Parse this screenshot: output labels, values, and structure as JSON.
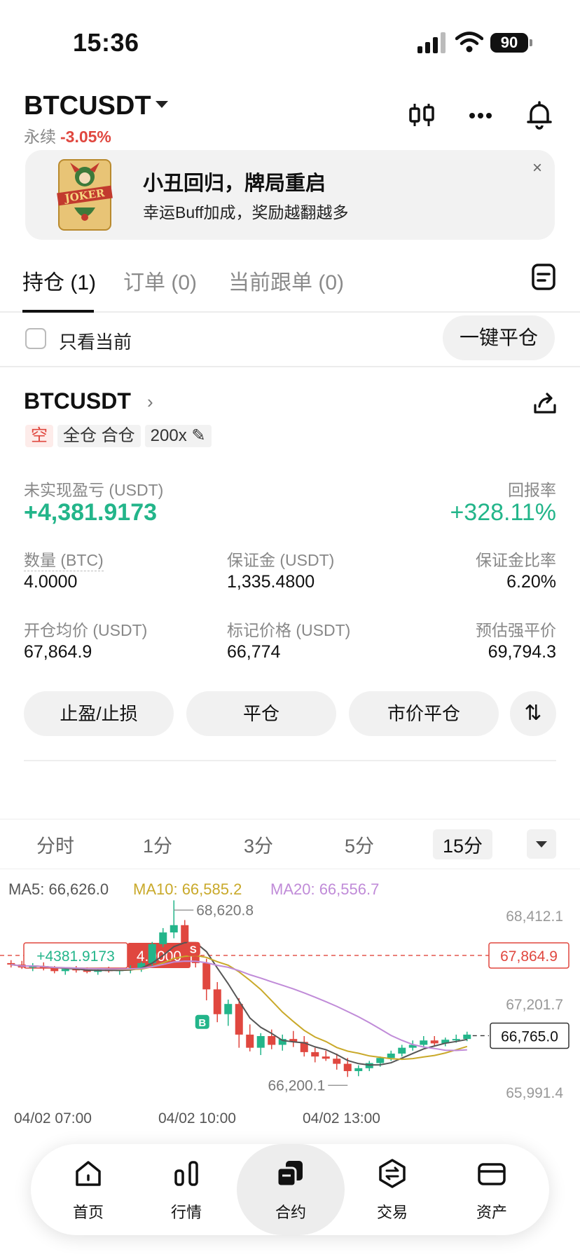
{
  "status": {
    "time": "15:36",
    "battery": "90"
  },
  "header": {
    "symbol": "BTCUSDT",
    "type": "永续",
    "change": "-3.05%"
  },
  "banner": {
    "title": "小丑回归，牌局重启",
    "subtitle": "幸运Buff加成，奖励越翻越多",
    "close": "×",
    "image_text": "JOKER"
  },
  "tabs": [
    {
      "label": "持仓 (1)"
    },
    {
      "label": "订单 (0)"
    },
    {
      "label": "当前跟单 (0)"
    }
  ],
  "filter": {
    "checkbox_label": "只看当前",
    "close_all": "一键平仓"
  },
  "position": {
    "symbol": "BTCUSDT",
    "side": "空",
    "margin_mode": "全仓 合仓",
    "leverage": "200x",
    "unrealized_label": "未实现盈亏 (USDT)",
    "unrealized_value": "+4,381.9173",
    "roe_label": "回报率",
    "roe_value": "+328.11%",
    "qty_label": "数量 (BTC)",
    "qty_value": "4.0000",
    "margin_label": "保证金 (USDT)",
    "margin_value": "1,335.4800",
    "margin_ratio_label": "保证金比率",
    "margin_ratio_value": "6.20%",
    "entry_label": "开仓均价 (USDT)",
    "entry_value": "67,864.9",
    "mark_label": "标记价格 (USDT)",
    "mark_value": "66,774",
    "liq_label": "预估强平价",
    "liq_value": "69,794.3",
    "btn_tpsl": "止盈/止损",
    "btn_close": "平仓",
    "btn_market_close": "市价平仓"
  },
  "timeframes": [
    {
      "label": "分时"
    },
    {
      "label": "1分"
    },
    {
      "label": "3分"
    },
    {
      "label": "5分"
    },
    {
      "label": "15分"
    }
  ],
  "chart_data": {
    "type": "candlestick",
    "ma": {
      "ma5": "MA5: 66,626.0",
      "ma10": "MA10: 66,585.2",
      "ma20": "MA20: 66,556.7"
    },
    "y_ticks": [
      "68,412.1",
      "67,201.7",
      "65,991.4"
    ],
    "x_ticks": [
      "04/02 07:00",
      "04/02 10:00",
      "04/02 13:00"
    ],
    "high_label": "68,620.8",
    "low_label": "66,200.1",
    "entry_line": "67,864.9",
    "current_price": "66,765.0",
    "pnl_tag": "+4381.9173",
    "qty_tag": "4.0000",
    "sell_marker": "S",
    "buy_marker": "B",
    "ylim": [
      65991.4,
      68412.1
    ],
    "candles": [
      [
        67760,
        67800,
        67700,
        67740
      ],
      [
        67740,
        67790,
        67680,
        67700
      ],
      [
        67700,
        67760,
        67650,
        67720
      ],
      [
        67720,
        67770,
        67660,
        67690
      ],
      [
        67690,
        67720,
        67620,
        67650
      ],
      [
        67650,
        67700,
        67600,
        67680
      ],
      [
        67680,
        67720,
        67630,
        67660
      ],
      [
        67660,
        67700,
        67620,
        67640
      ],
      [
        67640,
        67690,
        67600,
        67670
      ],
      [
        67670,
        67710,
        67630,
        67650
      ],
      [
        67650,
        67690,
        67600,
        67680
      ],
      [
        67680,
        67730,
        67620,
        67690
      ],
      [
        67690,
        67780,
        67640,
        67760
      ],
      [
        67760,
        68050,
        67720,
        68020
      ],
      [
        68020,
        68240,
        67980,
        68180
      ],
      [
        68180,
        68620,
        68100,
        68280
      ],
      [
        68280,
        68350,
        67900,
        67960
      ],
      [
        67960,
        68020,
        67700,
        67760
      ],
      [
        67760,
        67820,
        67250,
        67400
      ],
      [
        67400,
        67500,
        66950,
        67060
      ],
      [
        67060,
        67260,
        66900,
        67200
      ],
      [
        67200,
        67280,
        66600,
        66780
      ],
      [
        66780,
        66920,
        66550,
        66600
      ],
      [
        66600,
        66800,
        66500,
        66760
      ],
      [
        66760,
        66850,
        66580,
        66640
      ],
      [
        66640,
        66780,
        66560,
        66720
      ],
      [
        66720,
        66830,
        66610,
        66680
      ],
      [
        66680,
        66760,
        66480,
        66540
      ],
      [
        66540,
        66600,
        66400,
        66480
      ],
      [
        66480,
        66560,
        66420,
        66450
      ],
      [
        66450,
        66520,
        66300,
        66380
      ],
      [
        66380,
        66460,
        66200,
        66280
      ],
      [
        66280,
        66360,
        66210,
        66320
      ],
      [
        66320,
        66420,
        66280,
        66390
      ],
      [
        66390,
        66480,
        66340,
        66460
      ],
      [
        66460,
        66560,
        66420,
        66520
      ],
      [
        66520,
        66640,
        66480,
        66600
      ],
      [
        66600,
        66700,
        66560,
        66640
      ],
      [
        66640,
        66760,
        66600,
        66700
      ],
      [
        66700,
        66760,
        66620,
        66660
      ],
      [
        66660,
        66740,
        66620,
        66710
      ],
      [
        66710,
        66780,
        66670,
        66720
      ],
      [
        66720,
        66820,
        66690,
        66780
      ]
    ]
  },
  "bottom_nav": [
    {
      "label": "首页"
    },
    {
      "label": "行情"
    },
    {
      "label": "合约"
    },
    {
      "label": "交易"
    },
    {
      "label": "资产"
    }
  ],
  "colors": {
    "up": "#23b58a",
    "down": "#e0473f",
    "ma5": "#555555",
    "ma10": "#c9a92a",
    "ma20": "#c08bd8"
  }
}
